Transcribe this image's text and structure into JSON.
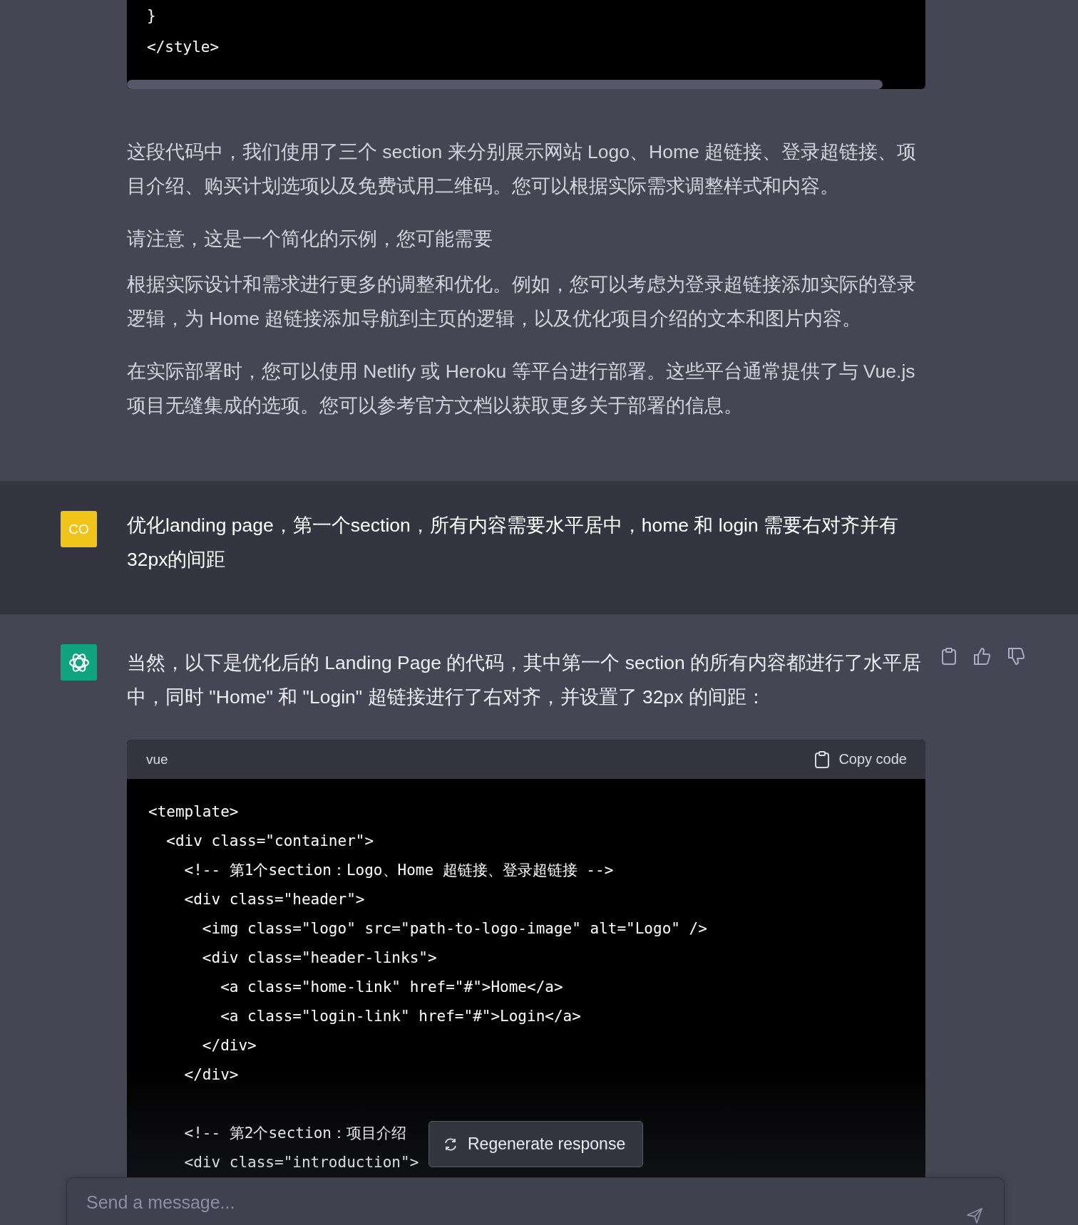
{
  "previous_code": {
    "lines": [
      "}",
      "</style>"
    ]
  },
  "assistant_paragraphs": [
    "这段代码中，我们使用了三个 section 来分别展示网站 Logo、Home 超链接、登录超链接、项目介绍、购买计划选项以及免费试用二维码。您可以根据实际需求调整样式和内容。",
    "请注意，这是一个简化的示例，您可能需要",
    "根据实际设计和需求进行更多的调整和优化。例如，您可以考虑为登录超链接添加实际的登录逻辑，为 Home 超链接添加导航到主页的逻辑，以及优化项目介绍的文本和图片内容。",
    "在实际部署时，您可以使用 Netlify 或 Heroku 等平台进行部署。这些平台通常提供了与 Vue.js 项目无缝集成的选项。您可以参考官方文档以获取更多关于部署的信息。"
  ],
  "user_message": {
    "avatar": "CO",
    "text": "优化landing page，第一个section，所有内容需要水平居中，home 和 login 需要右对齐并有32px的间距"
  },
  "reply": {
    "text": "当然，以下是优化后的 Landing Page 的代码，其中第一个 section 的所有内容都进行了水平居中，同时 \"Home\" 和 \"Login\" 超链接进行了右对齐，并设置了 32px 的间距：",
    "code_block": {
      "language": "vue",
      "copy_label": "Copy code",
      "line_groups": [
        [
          "<template>",
          "  <div class=\"container\">",
          "    <!-- 第1个section：Logo、Home 超链接、登录超链接 -->",
          "    <div class=\"header\">",
          "      <img class=\"logo\" src=\"path-to-logo-image\" alt=\"Logo\" />",
          "      <div class=\"header-links\">",
          "        <a class=\"home-link\" href=\"#\">Home</a>",
          "        <a class=\"login-link\" href=\"#\">Login</a>",
          "      </div>",
          "    </div>"
        ],
        [
          "    <!-- 第2个section：项目介绍",
          "    <div class=\"introduction\">"
        ]
      ]
    }
  },
  "regenerate_button": "Regenerate response",
  "composer": {
    "placeholder": "Send a message..."
  }
}
